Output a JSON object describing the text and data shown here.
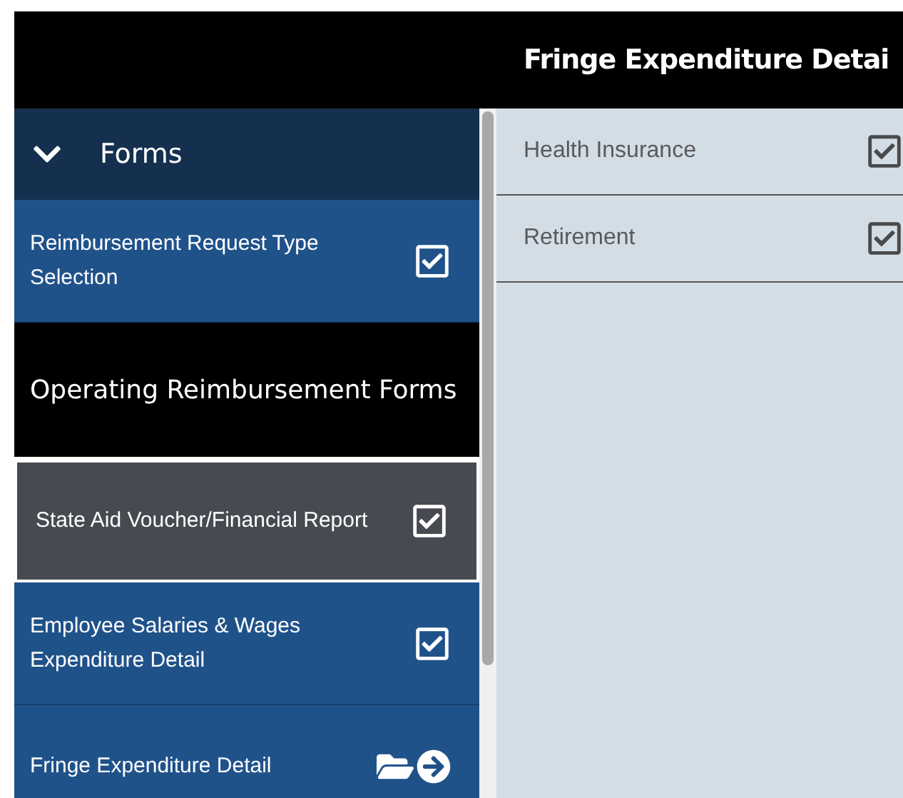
{
  "header": {
    "title": "Fringe Expenditure Detai"
  },
  "sidebar": {
    "title": "Forms",
    "expanded": true,
    "items": [
      {
        "kind": "form",
        "label": "Reimbursement Request Type Selection",
        "complete": true,
        "selected": false
      },
      {
        "kind": "section",
        "label": "Operating Reimbursement Forms"
      },
      {
        "kind": "form",
        "label": "State Aid Voucher/Financial Report",
        "complete": true,
        "selected": true
      },
      {
        "kind": "form",
        "label": "Employee Salaries & Wages Expenditure Detail",
        "complete": true,
        "selected": false
      },
      {
        "kind": "form",
        "label": "Fringe Expenditure Detail",
        "complete": false,
        "selected": false
      }
    ]
  },
  "content": {
    "rows": [
      {
        "label": "Health Insurance",
        "complete": true
      },
      {
        "label": "Retirement",
        "complete": true
      }
    ]
  }
}
